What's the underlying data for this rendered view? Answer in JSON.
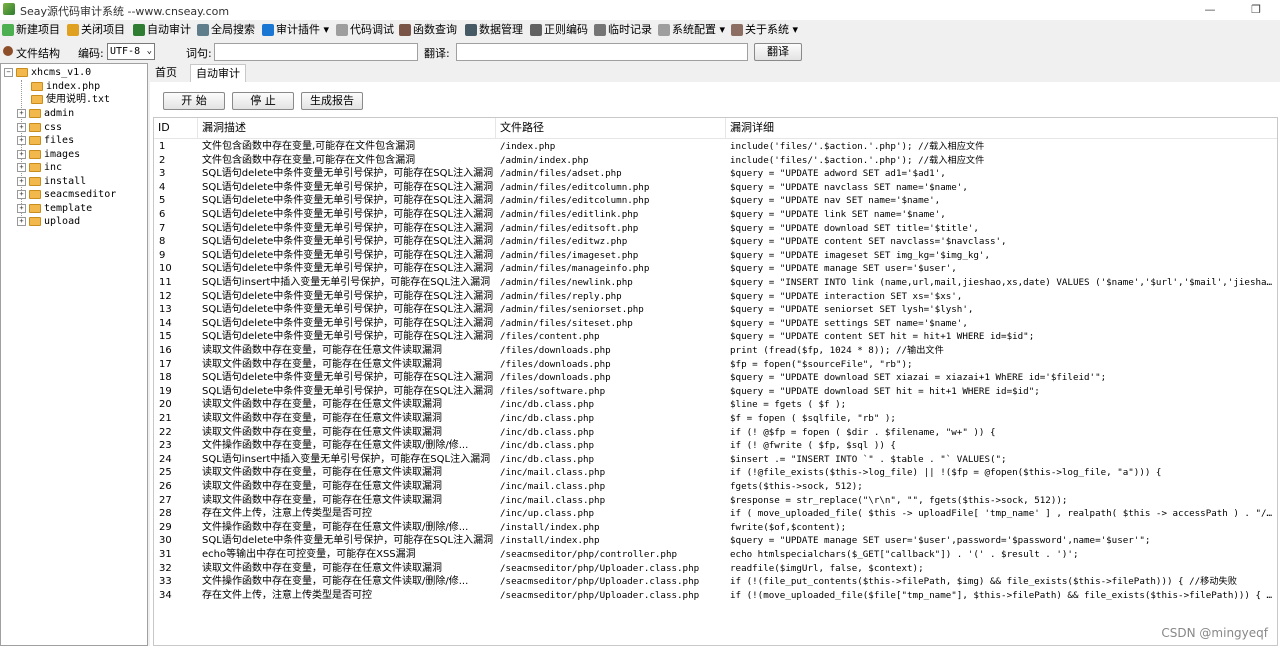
{
  "window": {
    "title": "Seay源代码审计系统 --www.cnseay.com",
    "minimize": "—",
    "maximize": "❐"
  },
  "toolbar": {
    "items": [
      {
        "label": "新建项目",
        "icon": "new-project-icon",
        "color": "#4caf50"
      },
      {
        "label": "关闭项目",
        "icon": "close-project-icon",
        "color": "#e0a020"
      },
      {
        "label": "自动审计",
        "icon": "auto-audit-icon",
        "color": "#2e7d32"
      },
      {
        "label": "全局搜索",
        "icon": "global-search-icon",
        "color": "#607d8b"
      },
      {
        "label": "审计插件 ▾",
        "icon": "plugin-icon",
        "color": "#1976d2"
      },
      {
        "label": "代码调试",
        "icon": "debug-icon",
        "color": "#9e9e9e"
      },
      {
        "label": "函数查询",
        "icon": "function-search-icon",
        "color": "#795548"
      },
      {
        "label": "数据管理",
        "icon": "data-manage-icon",
        "color": "#455a64"
      },
      {
        "label": "正则编码",
        "icon": "regex-icon",
        "color": "#616161"
      },
      {
        "label": "临时记录",
        "icon": "temp-record-icon",
        "color": "#757575"
      },
      {
        "label": "系统配置 ▾",
        "icon": "settings-icon",
        "color": "#9e9e9e"
      },
      {
        "label": "关于系统 ▾",
        "icon": "about-icon",
        "color": "#8d6e63"
      }
    ]
  },
  "options": {
    "file_structure": "文件结构",
    "encoding_label": "编码:",
    "encoding_value": "UTF-8",
    "word_label": "词句:",
    "word_value": "",
    "translate_label": "翻译:",
    "translate_value": "",
    "translate_button": "翻译"
  },
  "tree": {
    "root": "xhcms_v1.0",
    "children": [
      {
        "label": "index.php",
        "type": "file"
      },
      {
        "label": "使用说明.txt",
        "type": "file"
      },
      {
        "label": "admin",
        "type": "folder"
      },
      {
        "label": "css",
        "type": "folder"
      },
      {
        "label": "files",
        "type": "folder"
      },
      {
        "label": "images",
        "type": "folder"
      },
      {
        "label": "inc",
        "type": "folder"
      },
      {
        "label": "install",
        "type": "folder"
      },
      {
        "label": "seacmseditor",
        "type": "folder"
      },
      {
        "label": "template",
        "type": "folder"
      },
      {
        "label": "upload",
        "type": "folder"
      }
    ]
  },
  "tabs": [
    {
      "label": "首页",
      "active": false
    },
    {
      "label": "自动审计",
      "active": true
    }
  ],
  "actions": {
    "start": "开 始",
    "stop": "停 止",
    "report": "生成报告"
  },
  "table": {
    "columns": [
      "ID",
      "漏洞描述",
      "文件路径",
      "漏洞详细"
    ],
    "rows": [
      [
        "1",
        "文件包含函数中存在变量,可能存在文件包含漏洞",
        "/index.php",
        "include('files/'.$action.'.php'); //载入相应文件"
      ],
      [
        "2",
        "文件包含函数中存在变量,可能存在文件包含漏洞",
        "/admin/index.php",
        "include('files/'.$action.'.php'); //载入相应文件"
      ],
      [
        "3",
        "SQL语句delete中条件变量无单引号保护，可能存在SQL注入漏洞",
        "/admin/files/adset.php",
        "$query = \"UPDATE adword SET ad1='$ad1',"
      ],
      [
        "4",
        "SQL语句delete中条件变量无单引号保护，可能存在SQL注入漏洞",
        "/admin/files/editcolumn.php",
        "$query = \"UPDATE navclass SET name='$name',"
      ],
      [
        "5",
        "SQL语句delete中条件变量无单引号保护，可能存在SQL注入漏洞",
        "/admin/files/editcolumn.php",
        "$query = \"UPDATE nav SET name='$name',"
      ],
      [
        "6",
        "SQL语句delete中条件变量无单引号保护，可能存在SQL注入漏洞",
        "/admin/files/editlink.php",
        "$query = \"UPDATE link SET name='$name',"
      ],
      [
        "7",
        "SQL语句delete中条件变量无单引号保护，可能存在SQL注入漏洞",
        "/admin/files/editsoft.php",
        "$query = \"UPDATE download SET title='$title',"
      ],
      [
        "8",
        "SQL语句delete中条件变量无单引号保护，可能存在SQL注入漏洞",
        "/admin/files/editwz.php",
        "$query = \"UPDATE content SET navclass='$navclass',"
      ],
      [
        "9",
        "SQL语句delete中条件变量无单引号保护，可能存在SQL注入漏洞",
        "/admin/files/imageset.php",
        "$query = \"UPDATE imageset SET img_kg='$img_kg',"
      ],
      [
        "10",
        "SQL语句delete中条件变量无单引号保护，可能存在SQL注入漏洞",
        "/admin/files/manageinfo.php",
        "$query = \"UPDATE manage SET user='$user',"
      ],
      [
        "11",
        "SQL语句insert中插入变量无单引号保护，可能存在SQL注入漏洞",
        "/admin/files/newlink.php",
        "$query = \"INSERT INTO link (name,url,mail,jieshao,xs,date) VALUES ('$name','$url','$mail','jieshao','xs..."
      ],
      [
        "12",
        "SQL语句delete中条件变量无单引号保护，可能存在SQL注入漏洞",
        "/admin/files/reply.php",
        "$query = \"UPDATE interaction SET xs='$xs',"
      ],
      [
        "13",
        "SQL语句delete中条件变量无单引号保护，可能存在SQL注入漏洞",
        "/admin/files/seniorset.php",
        "$query = \"UPDATE seniorset SET lysh='$lysh',"
      ],
      [
        "14",
        "SQL语句delete中条件变量无单引号保护，可能存在SQL注入漏洞",
        "/admin/files/siteset.php",
        "$query = \"UPDATE settings SET name='$name',"
      ],
      [
        "15",
        "SQL语句delete中条件变量无单引号保护，可能存在SQL注入漏洞",
        "/files/content.php",
        "$query = \"UPDATE content SET hit = hit+1 WHERE id=$id\";"
      ],
      [
        "16",
        "读取文件函数中存在变量，可能存在任意文件读取漏洞",
        "/files/downloads.php",
        "print (fread($fp, 1024 * 8)); //输出文件"
      ],
      [
        "17",
        "读取文件函数中存在变量，可能存在任意文件读取漏洞",
        "/files/downloads.php",
        "$fp = fopen(\"$sourceFile\", \"rb\");"
      ],
      [
        "18",
        "SQL语句delete中条件变量无单引号保护，可能存在SQL注入漏洞",
        "/files/downloads.php",
        "$query = \"UPDATE download SET xiazai = xiazai+1 WhERE id='$fileid'\";"
      ],
      [
        "19",
        "SQL语句delete中条件变量无单引号保护，可能存在SQL注入漏洞",
        "/files/software.php",
        "$query = \"UPDATE download SET hit = hit+1 WHERE id=$id\";"
      ],
      [
        "20",
        "读取文件函数中存在变量，可能存在任意文件读取漏洞",
        "/inc/db.class.php",
        "$line = fgets ( $f );"
      ],
      [
        "21",
        "读取文件函数中存在变量，可能存在任意文件读取漏洞",
        "/inc/db.class.php",
        "$f = fopen ( $sqlfile, \"rb\" );"
      ],
      [
        "22",
        "读取文件函数中存在变量，可能存在任意文件读取漏洞",
        "/inc/db.class.php",
        "if (! @$fp = fopen ( $dir . $filename, \"w+\" )) {"
      ],
      [
        "23",
        "文件操作函数中存在变量，可能存在任意文件读取/删除/修...",
        "/inc/db.class.php",
        "if (! @fwrite ( $fp, $sql )) {"
      ],
      [
        "24",
        "SQL语句insert中插入变量无单引号保护，可能存在SQL注入漏洞",
        "/inc/db.class.php",
        "$insert .= \"INSERT INTO `\" . $table . \"` VALUES(\";"
      ],
      [
        "25",
        "读取文件函数中存在变量，可能存在任意文件读取漏洞",
        "/inc/mail.class.php",
        "if (!@file_exists($this->log_file) || !($fp = @fopen($this->log_file, \"a\"))) {"
      ],
      [
        "26",
        "读取文件函数中存在变量，可能存在任意文件读取漏洞",
        "/inc/mail.class.php",
        "fgets($this->sock, 512);"
      ],
      [
        "27",
        "读取文件函数中存在变量，可能存在任意文件读取漏洞",
        "/inc/mail.class.php",
        "$response = str_replace(\"\\r\\n\", \"\", fgets($this->sock, 512));"
      ],
      [
        "28",
        "存在文件上传，注意上传类型是否可控",
        "/inc/up.class.php",
        "if ( move_uploaded_file( $this -> uploadFile[ 'tmp_name' ] , realpath( $this -> accessPath ) . \"/\" . $n..."
      ],
      [
        "29",
        "文件操作函数中存在变量，可能存在任意文件读取/删除/修...",
        "/install/index.php",
        "fwrite($of,$content);"
      ],
      [
        "30",
        "SQL语句delete中条件变量无单引号保护，可能存在SQL注入漏洞",
        "/install/index.php",
        "$query = \"UPDATE manage SET user='$user',password='$password',name='$user'\";"
      ],
      [
        "31",
        "echo等输出中存在可控变量，可能存在XSS漏洞",
        "/seacmseditor/php/controller.php",
        "echo htmlspecialchars($_GET[\"callback\"]) . '(' . $result . ')';"
      ],
      [
        "32",
        "读取文件函数中存在变量，可能存在任意文件读取漏洞",
        "/seacmseditor/php/Uploader.class.php",
        "readfile($imgUrl, false, $context);"
      ],
      [
        "33",
        "文件操作函数中存在变量，可能存在任意文件读取/删除/修...",
        "/seacmseditor/php/Uploader.class.php",
        "if (!(file_put_contents($this->filePath, $img) && file_exists($this->filePath))) { //移动失败"
      ],
      [
        "34",
        "存在文件上传，注意上传类型是否可控",
        "/seacmseditor/php/Uploader.class.php",
        "if (!(move_uploaded_file($file[\"tmp_name\"], $this->filePath) && file_exists($this->filePath))) { //移动..."
      ]
    ]
  },
  "watermark": "CSDN @mingyeqf"
}
